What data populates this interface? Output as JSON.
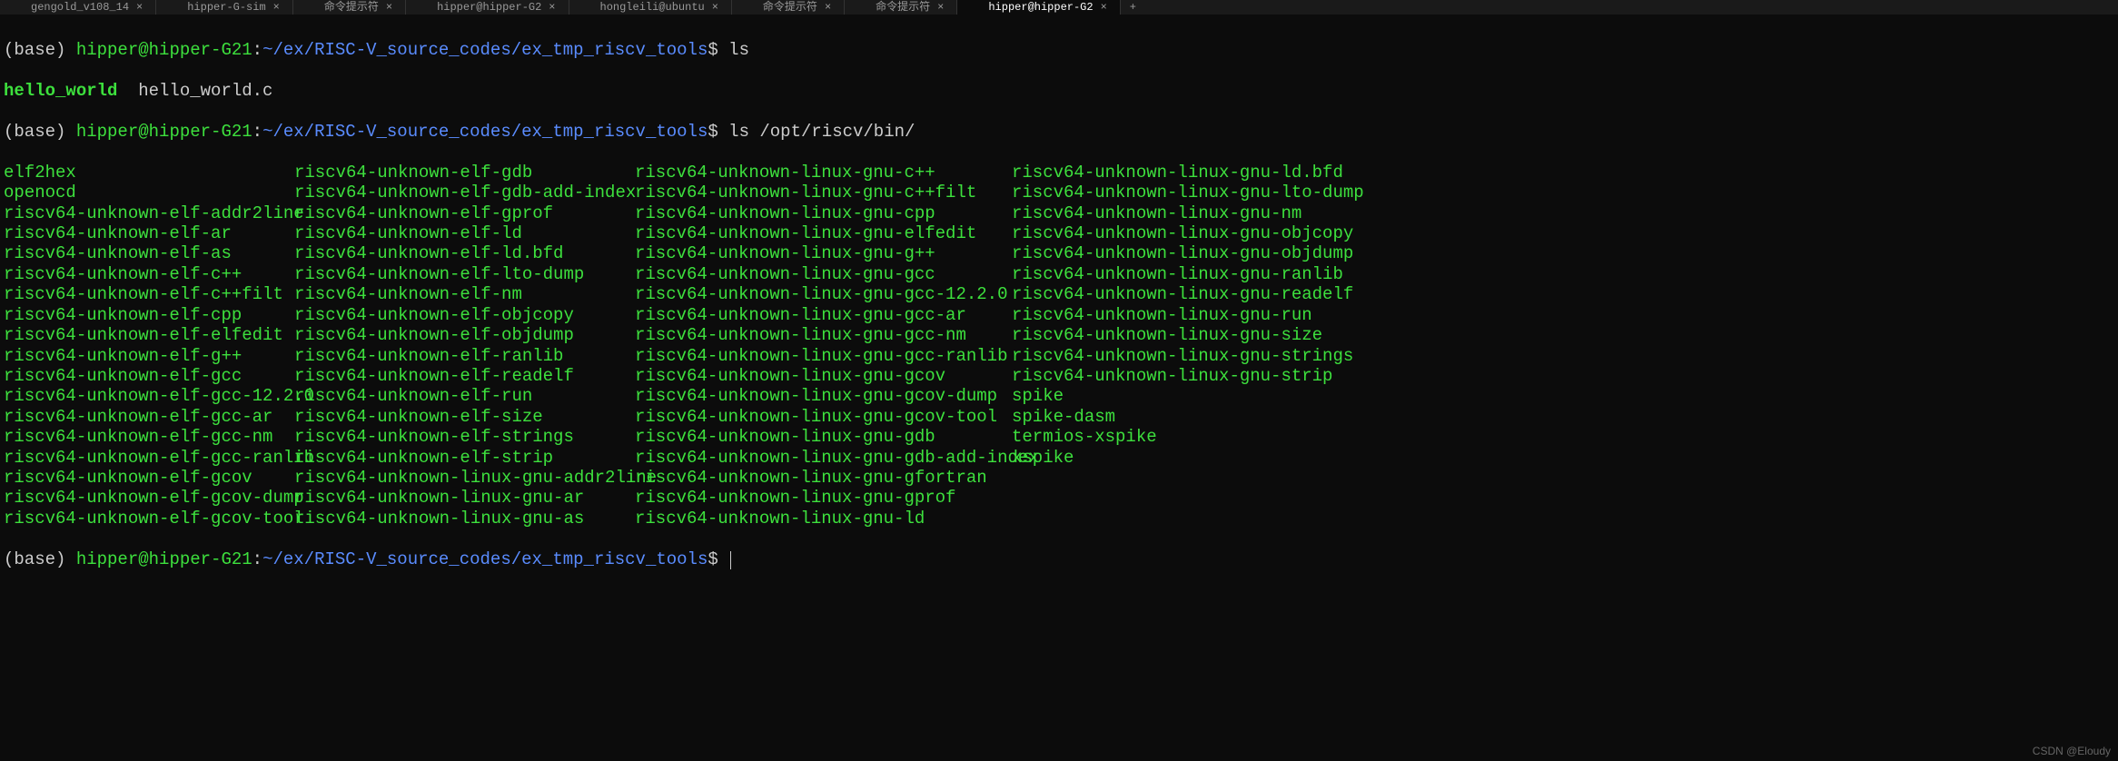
{
  "tabs": [
    {
      "label": "gengold_v108_14"
    },
    {
      "label": "hipper-G-sim"
    },
    {
      "label": "命令提示符"
    },
    {
      "label": "hipper@hipper-G2"
    },
    {
      "label": "hongleili@ubuntu"
    },
    {
      "label": "命令提示符"
    },
    {
      "label": "命令提示符"
    },
    {
      "label": "hipper@hipper-G2"
    }
  ],
  "prompt": {
    "base": "(base) ",
    "user": "hipper@hipper-G21",
    "colon": ":",
    "path": "~/ex/RISC-V_source_codes/ex_tmp_riscv_tools",
    "dollar": "$ "
  },
  "commands": {
    "cmd1": "ls",
    "cmd2": "ls /opt/riscv/bin/"
  },
  "ls_output1": {
    "exec": "hello_world",
    "normal": "  hello_world.c"
  },
  "ls_output2": {
    "col1": [
      "elf2hex",
      "openocd",
      "riscv64-unknown-elf-addr2line",
      "riscv64-unknown-elf-ar",
      "riscv64-unknown-elf-as",
      "riscv64-unknown-elf-c++",
      "riscv64-unknown-elf-c++filt",
      "riscv64-unknown-elf-cpp",
      "riscv64-unknown-elf-elfedit",
      "riscv64-unknown-elf-g++",
      "riscv64-unknown-elf-gcc",
      "riscv64-unknown-elf-gcc-12.2.0",
      "riscv64-unknown-elf-gcc-ar",
      "riscv64-unknown-elf-gcc-nm",
      "riscv64-unknown-elf-gcc-ranlib",
      "riscv64-unknown-elf-gcov",
      "riscv64-unknown-elf-gcov-dump",
      "riscv64-unknown-elf-gcov-tool"
    ],
    "col2": [
      "riscv64-unknown-elf-gdb",
      "riscv64-unknown-elf-gdb-add-index",
      "riscv64-unknown-elf-gprof",
      "riscv64-unknown-elf-ld",
      "riscv64-unknown-elf-ld.bfd",
      "riscv64-unknown-elf-lto-dump",
      "riscv64-unknown-elf-nm",
      "riscv64-unknown-elf-objcopy",
      "riscv64-unknown-elf-objdump",
      "riscv64-unknown-elf-ranlib",
      "riscv64-unknown-elf-readelf",
      "riscv64-unknown-elf-run",
      "riscv64-unknown-elf-size",
      "riscv64-unknown-elf-strings",
      "riscv64-unknown-elf-strip",
      "riscv64-unknown-linux-gnu-addr2line",
      "riscv64-unknown-linux-gnu-ar",
      "riscv64-unknown-linux-gnu-as"
    ],
    "col3": [
      "riscv64-unknown-linux-gnu-c++",
      "riscv64-unknown-linux-gnu-c++filt",
      "riscv64-unknown-linux-gnu-cpp",
      "riscv64-unknown-linux-gnu-elfedit",
      "riscv64-unknown-linux-gnu-g++",
      "riscv64-unknown-linux-gnu-gcc",
      "riscv64-unknown-linux-gnu-gcc-12.2.0",
      "riscv64-unknown-linux-gnu-gcc-ar",
      "riscv64-unknown-linux-gnu-gcc-nm",
      "riscv64-unknown-linux-gnu-gcc-ranlib",
      "riscv64-unknown-linux-gnu-gcov",
      "riscv64-unknown-linux-gnu-gcov-dump",
      "riscv64-unknown-linux-gnu-gcov-tool",
      "riscv64-unknown-linux-gnu-gdb",
      "riscv64-unknown-linux-gnu-gdb-add-index",
      "riscv64-unknown-linux-gnu-gfortran",
      "riscv64-unknown-linux-gnu-gprof",
      "riscv64-unknown-linux-gnu-ld"
    ],
    "col4": [
      "riscv64-unknown-linux-gnu-ld.bfd",
      "riscv64-unknown-linux-gnu-lto-dump",
      "riscv64-unknown-linux-gnu-nm",
      "riscv64-unknown-linux-gnu-objcopy",
      "riscv64-unknown-linux-gnu-objdump",
      "riscv64-unknown-linux-gnu-ranlib",
      "riscv64-unknown-linux-gnu-readelf",
      "riscv64-unknown-linux-gnu-run",
      "riscv64-unknown-linux-gnu-size",
      "riscv64-unknown-linux-gnu-strings",
      "riscv64-unknown-linux-gnu-strip",
      "spike",
      "spike-dasm",
      "termios-xspike",
      "xspike",
      "",
      "",
      ""
    ]
  },
  "watermark": "CSDN @Eloudy"
}
